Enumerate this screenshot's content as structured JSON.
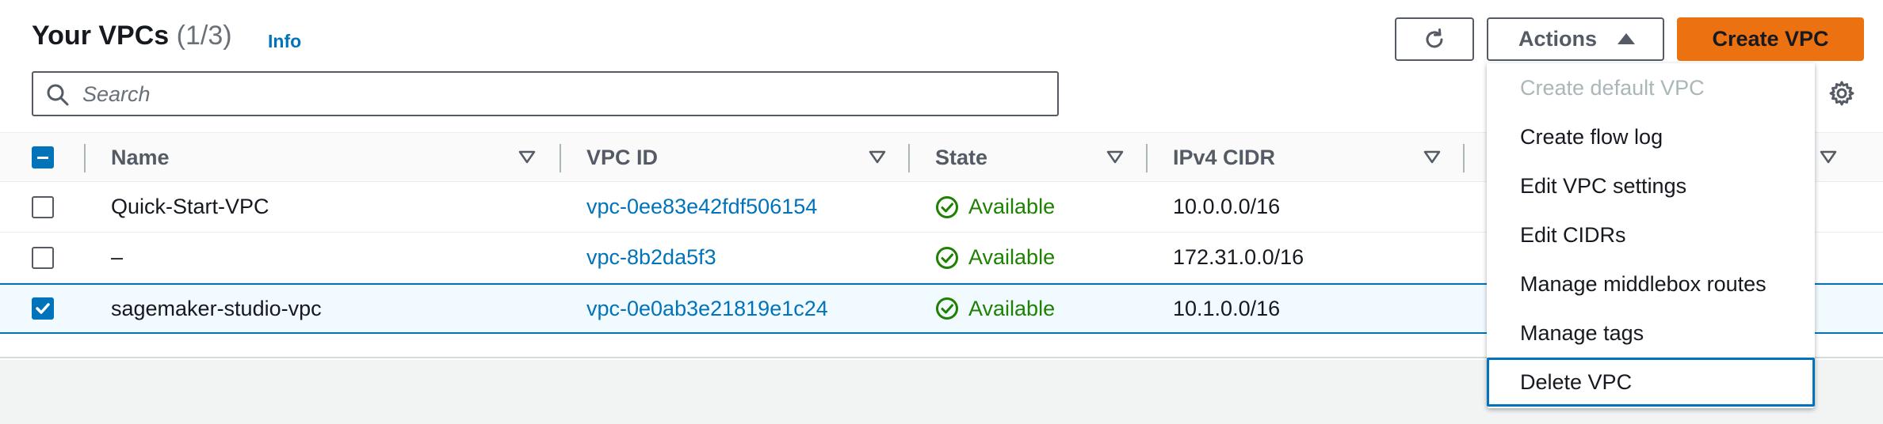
{
  "header": {
    "title": "Your VPCs",
    "count": "(1/3)",
    "info_link": "Info"
  },
  "toolbar": {
    "refresh_icon": "refresh-icon",
    "actions_label": "Actions",
    "create_label": "Create VPC",
    "create_color": "#ec7211"
  },
  "search": {
    "placeholder": "Search",
    "value": ""
  },
  "table": {
    "columns": [
      "Name",
      "VPC ID",
      "State",
      "IPv4 CIDR",
      ""
    ],
    "rows": [
      {
        "name": "Quick-Start-VPC",
        "vpc_id": "vpc-0ee83e42fdf506154",
        "state": "Available",
        "cidr": "10.0.0.0/16",
        "checked": false
      },
      {
        "name": "–",
        "vpc_id": "vpc-8b2da5f3",
        "state": "Available",
        "cidr": "172.31.0.0/16",
        "checked": false
      },
      {
        "name": "sagemaker-studio-vpc",
        "vpc_id": "vpc-0e0ab3e21819e1c24",
        "state": "Available",
        "cidr": "10.1.0.0/16",
        "checked": true
      }
    ]
  },
  "actions_menu": {
    "items": [
      {
        "label": "Create default VPC",
        "disabled": true
      },
      {
        "label": "Create flow log",
        "disabled": false
      },
      {
        "label": "Edit VPC settings",
        "disabled": false
      },
      {
        "label": "Edit CIDRs",
        "disabled": false
      },
      {
        "label": "Manage middlebox routes",
        "disabled": false
      },
      {
        "label": "Manage tags",
        "disabled": false
      },
      {
        "label": "Delete VPC",
        "disabled": false,
        "focused": true
      }
    ]
  },
  "colors": {
    "link": "#0073bb",
    "status_ok": "#1d8102",
    "disabled": "#aab7b8"
  }
}
